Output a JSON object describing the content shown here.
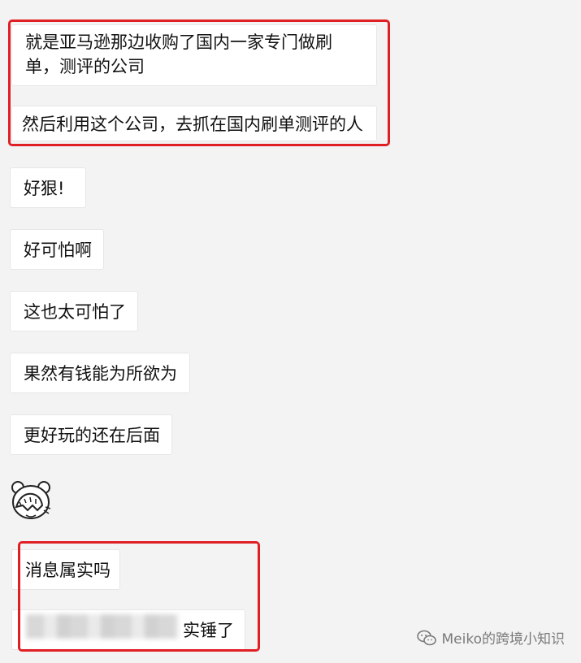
{
  "messages": [
    {
      "text": "就是亚马逊那边收购了国内一家专门做刷单，测评的公司"
    },
    {
      "text": "然后利用这个公司，去抓在国内刷单测评的人"
    },
    {
      "text": "好狠!"
    },
    {
      "text": "好可怕啊"
    },
    {
      "text": "这也太可怕了"
    },
    {
      "text": "果然有钱能为所欲为"
    },
    {
      "text": "更好玩的还在后面"
    },
    {
      "text": "消息属实吗"
    },
    {
      "text": "实锤了"
    }
  ],
  "sticker": {
    "icon": "face-palm-bear-icon"
  },
  "watermark": {
    "text": "Meiko的跨境小知识",
    "icon": "wechat-channel-icon"
  },
  "colors": {
    "highlight": "#e01f25",
    "bubble": "#ffffff",
    "background": "#f3f3f3"
  }
}
